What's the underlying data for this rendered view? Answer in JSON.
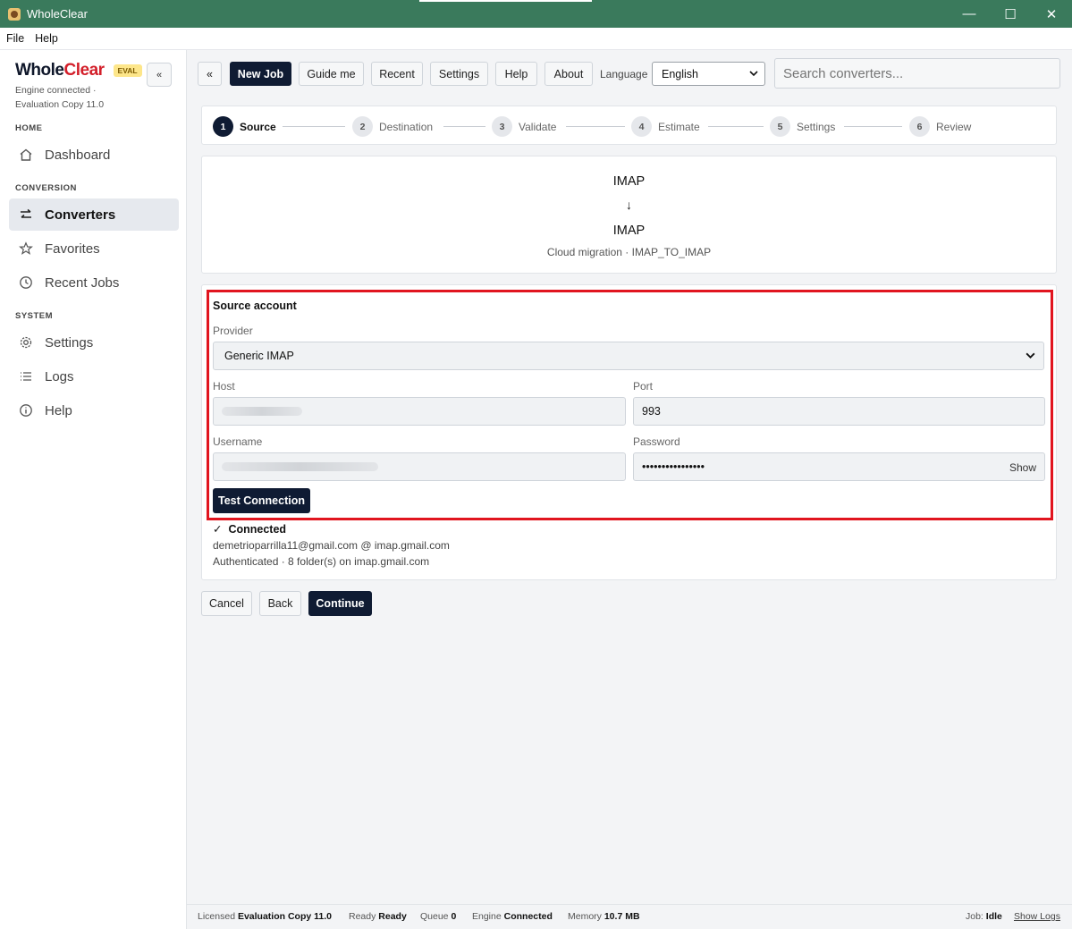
{
  "window": {
    "title": "WholeClear",
    "minimize": "—",
    "maximize": "☐",
    "close": "✕"
  },
  "menu": {
    "file": "File",
    "help": "Help"
  },
  "sidebar": {
    "brand_whole": "Whole",
    "brand_clear": "Clear",
    "eval_badge": "EVAL",
    "collapse": "«",
    "engine_line1": "Engine connected ·",
    "engine_line2": "Evaluation Copy 11.0",
    "sections": {
      "home": "HOME",
      "conversion": "CONVERSION",
      "system": "SYSTEM"
    },
    "items": {
      "dashboard": "Dashboard",
      "converters": "Converters",
      "favorites": "Favorites",
      "recent_jobs": "Recent Jobs",
      "settings": "Settings",
      "logs": "Logs",
      "help": "Help"
    }
  },
  "toolbar": {
    "back": "«",
    "new_job": "New Job",
    "guide_me": "Guide me",
    "recent": "Recent",
    "settings": "Settings",
    "help": "Help",
    "about": "About",
    "language_label": "Language",
    "language_value": "English",
    "search_placeholder": "Search converters..."
  },
  "steps": [
    {
      "num": "1",
      "label": "Source"
    },
    {
      "num": "2",
      "label": "Destination"
    },
    {
      "num": "3",
      "label": "Validate"
    },
    {
      "num": "4",
      "label": "Estimate"
    },
    {
      "num": "5",
      "label": "Settings"
    },
    {
      "num": "6",
      "label": "Review"
    }
  ],
  "route": {
    "from": "IMAP",
    "arrow": "↓",
    "to": "IMAP",
    "subtitle": "Cloud migration · IMAP_TO_IMAP"
  },
  "source": {
    "title": "Source account",
    "provider_label": "Provider",
    "provider_value": "Generic IMAP",
    "host_label": "Host",
    "port_label": "Port",
    "port_value": "993",
    "username_label": "Username",
    "password_label": "Password",
    "password_value": "••••••••••••••••",
    "show_label": "Show",
    "test_button": "Test Connection",
    "status_check": "✓",
    "status_text": "Connected",
    "account_line": "demetrioparrilla11@gmail.com @ imap.gmail.com",
    "auth_line": "Authenticated · 8 folder(s) on imap.gmail.com"
  },
  "actions": {
    "cancel": "Cancel",
    "back": "Back",
    "continue": "Continue"
  },
  "status_bar": {
    "licensed_label": "Licensed",
    "licensed_value": "Evaluation Copy 11.0",
    "ready_label": "Ready",
    "ready_value": "Ready",
    "queue_label": "Queue",
    "queue_value": "0",
    "engine_label": "Engine",
    "engine_value": "Connected",
    "memory_label": "Memory",
    "memory_value": "10.7 MB",
    "job_label": "Job:",
    "job_value": "Idle",
    "show_logs": "Show Logs"
  },
  "colors": {
    "titlebar": "#3a7a5c",
    "primary": "#0f1b33",
    "brand_red": "#d31f2a",
    "highlight": "#e1151f"
  }
}
